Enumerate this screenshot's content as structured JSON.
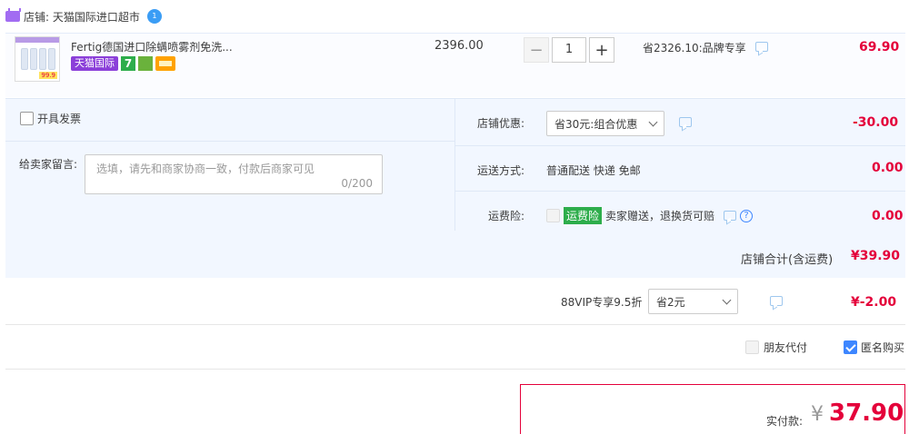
{
  "shop": {
    "label": "店铺: 天猫国际进口超市"
  },
  "item": {
    "title": "Fertig德国进口除螨喷雾剂免洗...",
    "thumb_price": "99.9",
    "tags": {
      "tmall": "天猫国际",
      "seven": "7"
    },
    "unit_price": "2396.00",
    "quantity": "1",
    "minus": "−",
    "plus": "+",
    "promo": "省2326.10:品牌专享",
    "subtotal": "69.90"
  },
  "invoice": {
    "label": "开具发票"
  },
  "message": {
    "label": "给卖家留言:",
    "placeholder": "选填，请先和商家协商一致，付款后商家可见",
    "count": "0/200"
  },
  "discount": {
    "label": "店铺优惠:",
    "selected": "省30元:组合优惠",
    "amount": "-30.00"
  },
  "delivery": {
    "label": "运送方式:",
    "value": "普通配送 快递 免邮",
    "amount": "0.00"
  },
  "insurance": {
    "label": "运费险:",
    "badge": "运费险",
    "text": "卖家赠送，退换货可赔",
    "amount": "0.00"
  },
  "shop_total": {
    "label": "店铺合计(含运费)",
    "amount": "¥39.90"
  },
  "vip": {
    "label": "88VIP专享9.5折",
    "selected": "省2元",
    "amount": "¥-2.00"
  },
  "options": {
    "friend_pay": "朋友代付",
    "anonymous": "匿名购买"
  },
  "pay": {
    "label": "实付款:",
    "currency": "¥",
    "amount": "37.90"
  },
  "colors": {
    "price_red": "#e4003a",
    "accent_blue": "#3d86ff",
    "tmall_purple": "#8b3fd9"
  }
}
